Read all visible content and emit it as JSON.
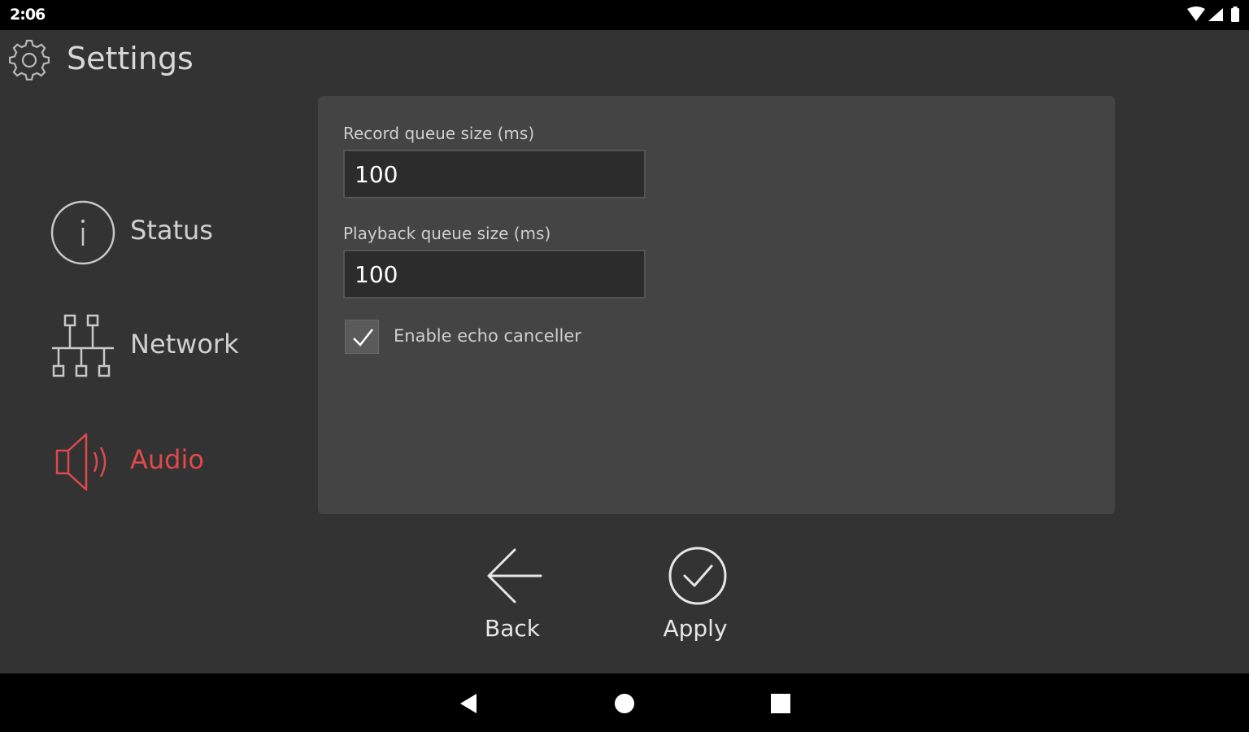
{
  "status_bar": {
    "time": "2:06",
    "icons": [
      "wifi-icon",
      "cellular-signal-icon",
      "battery-icon"
    ]
  },
  "header": {
    "title": "Settings",
    "icon": "gear-icon"
  },
  "sidebar": {
    "items": [
      {
        "label": "Status",
        "icon": "info-icon",
        "active": false
      },
      {
        "label": "Network",
        "icon": "network-icon",
        "active": false
      },
      {
        "label": "Audio",
        "icon": "speaker-icon",
        "active": true
      }
    ]
  },
  "audio_settings": {
    "record_queue": {
      "label": "Record queue size (ms)",
      "value": "100"
    },
    "playback_queue": {
      "label": "Playback queue size (ms)",
      "value": "100"
    },
    "echo_canceller": {
      "label": "Enable echo canceller",
      "checked": true
    }
  },
  "actions": {
    "back_label": "Back",
    "apply_label": "Apply"
  },
  "nav_bar": {
    "icons": [
      "back-triangle-icon",
      "home-circle-icon",
      "recents-square-icon"
    ]
  },
  "colors": {
    "background": "#333333",
    "panel": "#444444",
    "accent_active": "#e04a4a",
    "text": "#d0d0d0"
  }
}
